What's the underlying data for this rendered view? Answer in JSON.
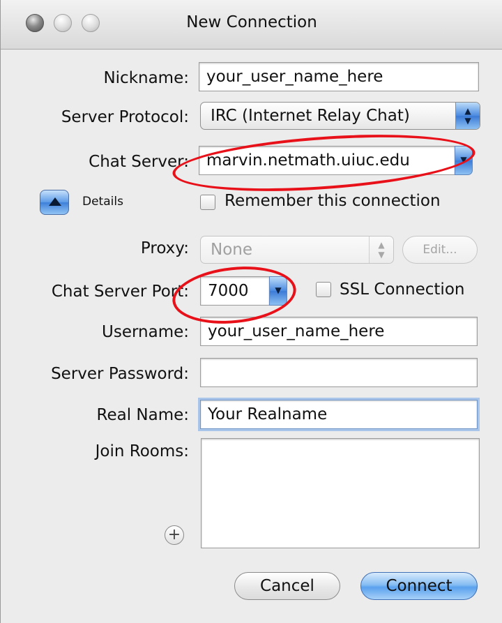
{
  "window": {
    "title": "New Connection"
  },
  "form": {
    "nickname": {
      "label": "Nickname:",
      "value": "your_user_name_here"
    },
    "protocol": {
      "label": "Server Protocol:",
      "value": "IRC (Internet Relay Chat)"
    },
    "chat_server": {
      "label": "Chat Server:",
      "value": "marvin.netmath.uiuc.edu"
    },
    "details": {
      "label": "Details"
    },
    "remember": {
      "label": "Remember this connection",
      "checked": false
    },
    "proxy": {
      "label": "Proxy:",
      "value": "None",
      "edit_label": "Edit..."
    },
    "port": {
      "label": "Chat Server Port:",
      "value": "7000"
    },
    "ssl": {
      "label": "SSL Connection",
      "checked": false
    },
    "username": {
      "label": "Username:",
      "value": "your_user_name_here"
    },
    "server_password": {
      "label": "Server Password:",
      "value": ""
    },
    "real_name": {
      "label": "Real Name:",
      "value": "Your Realname"
    },
    "join_rooms": {
      "label": "Join Rooms:"
    }
  },
  "buttons": {
    "cancel": "Cancel",
    "connect": "Connect"
  },
  "colors": {
    "highlight_ellipse": "#e8111a",
    "default_button": "#5aa1ed"
  },
  "icons": {
    "close": "close-icon",
    "minimize": "minimize-icon",
    "zoom": "zoom-icon",
    "disclosure": "disclosure-triangle-icon",
    "add": "plus-icon"
  }
}
